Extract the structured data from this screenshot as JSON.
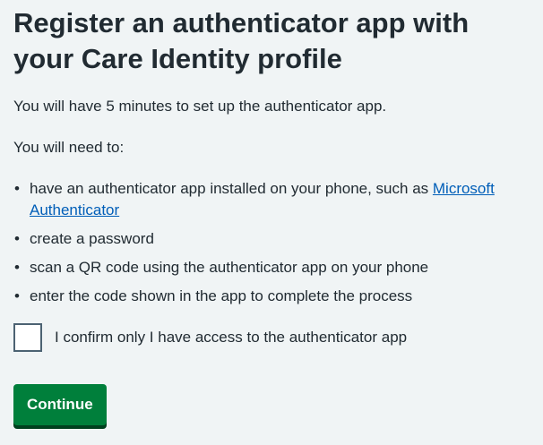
{
  "heading": "Register an authenticator app with your Care Identity profile",
  "intro": "You will have 5 minutes to set up the authenticator app.",
  "need_label": "You will need to:",
  "list": {
    "item1_prefix": "have an authenticator app installed on your phone, such as ",
    "item1_link": "Microsoft Authenticator",
    "item2": "create a password",
    "item3": "scan a QR code using the authenticator app on your phone",
    "item4": "enter the code shown in the app to complete the process"
  },
  "confirm_label": "I confirm only I have access to the authenticator app",
  "continue_label": "Continue",
  "colors": {
    "background": "#f0f4f5",
    "text": "#212b32",
    "link": "#005eb8",
    "button": "#007f3b",
    "button_shadow": "#00401e"
  }
}
